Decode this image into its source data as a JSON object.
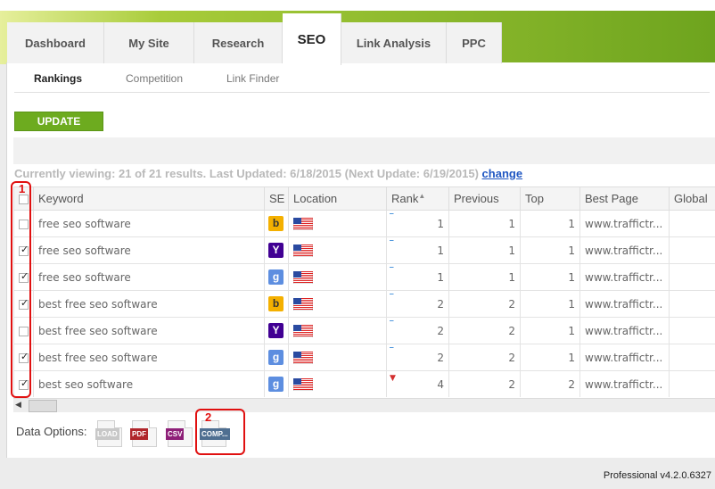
{
  "tabs": [
    {
      "label": "Dashboard"
    },
    {
      "label": "My Site"
    },
    {
      "label": "Research"
    },
    {
      "label": "SEO"
    },
    {
      "label": "Link Analysis"
    },
    {
      "label": "PPC"
    }
  ],
  "subtabs": [
    {
      "label": "Rankings"
    },
    {
      "label": "Competition"
    },
    {
      "label": "Link Finder"
    }
  ],
  "update_label": "UPDATE",
  "status": {
    "text": "Currently viewing: 21 of 21 results. Last Updated: 6/18/2015 (Next Update: 6/19/2015)",
    "change": "change"
  },
  "table": {
    "headers": {
      "keyword": "Keyword",
      "se": "SE",
      "location": "Location",
      "rank": "Rank",
      "previous": "Previous",
      "top": "Top",
      "best_page": "Best Page",
      "global": "Global"
    },
    "rows": [
      {
        "checked": false,
        "keyword": "free seo software",
        "se": "bing-icon",
        "se_char": "b",
        "location": "us-flag-icon",
        "rank": "1",
        "trend": "flat",
        "trend_char": "‾",
        "previous": "1",
        "top": "1",
        "best_page": "www.traffictr..."
      },
      {
        "checked": true,
        "keyword": "free seo software",
        "se": "yahoo-icon",
        "se_char": "Y",
        "location": "us-flag-icon",
        "rank": "1",
        "trend": "flat",
        "trend_char": "‾",
        "previous": "1",
        "top": "1",
        "best_page": "www.traffictr..."
      },
      {
        "checked": true,
        "keyword": "free seo software",
        "se": "google-icon",
        "se_char": "g",
        "location": "us-flag-icon",
        "rank": "1",
        "trend": "flat",
        "trend_char": "‾",
        "previous": "1",
        "top": "1",
        "best_page": "www.traffictr..."
      },
      {
        "checked": true,
        "keyword": "best free seo software",
        "se": "bing-icon",
        "se_char": "b",
        "location": "us-flag-icon",
        "rank": "2",
        "trend": "flat",
        "trend_char": "‾",
        "previous": "2",
        "top": "1",
        "best_page": "www.traffictr..."
      },
      {
        "checked": false,
        "keyword": "best free seo software",
        "se": "yahoo-icon",
        "se_char": "Y",
        "location": "us-flag-icon",
        "rank": "2",
        "trend": "flat",
        "trend_char": "‾",
        "previous": "2",
        "top": "1",
        "best_page": "www.traffictr..."
      },
      {
        "checked": true,
        "keyword": "best free seo software",
        "se": "google-icon",
        "se_char": "g",
        "location": "us-flag-icon",
        "rank": "2",
        "trend": "flat",
        "trend_char": "‾",
        "previous": "2",
        "top": "1",
        "best_page": "www.traffictr..."
      },
      {
        "checked": true,
        "keyword": "best seo software",
        "se": "google-icon",
        "se_char": "g",
        "location": "us-flag-icon",
        "rank": "4",
        "trend": "down",
        "trend_char": "▼",
        "previous": "2",
        "top": "2",
        "best_page": "www.traffictr..."
      }
    ]
  },
  "data_options": {
    "label": "Data Options:",
    "exports": [
      {
        "label": "LOAD",
        "color": "#c8c8c8"
      },
      {
        "label": "PDF",
        "color": "#b0262b"
      },
      {
        "label": "CSV",
        "color": "#8e1f78"
      },
      {
        "label": "COMP...",
        "color": "#4f6f91"
      }
    ]
  },
  "annotations": [
    "1",
    "2"
  ],
  "version": "Professional v4.2.0.6327",
  "colors": {
    "accent_green": "#6dab1f",
    "link_blue": "#1f56c2",
    "annotation_red": "#e01010"
  }
}
